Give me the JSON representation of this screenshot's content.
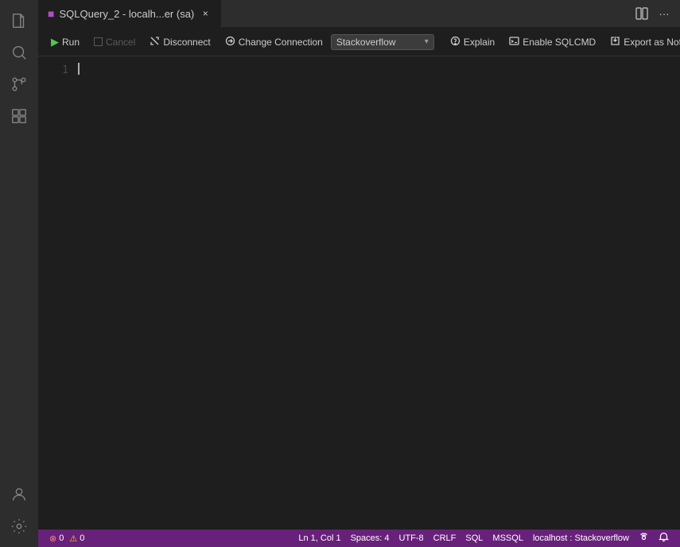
{
  "window": {
    "title": "SQLQuery_2 - localh...er (sa)"
  },
  "activity_bar": {
    "icons": [
      {
        "name": "files-icon",
        "symbol": "⧉",
        "tooltip": "Explorer"
      },
      {
        "name": "search-activity-icon",
        "symbol": "🔍",
        "tooltip": "Search"
      },
      {
        "name": "source-control-icon",
        "symbol": "⑂",
        "tooltip": "Source Control"
      },
      {
        "name": "extensions-icon",
        "symbol": "⊞",
        "tooltip": "Extensions"
      }
    ],
    "bottom_icons": [
      {
        "name": "account-icon",
        "symbol": "👤",
        "tooltip": "Account"
      },
      {
        "name": "settings-icon",
        "symbol": "⚙",
        "tooltip": "Settings"
      }
    ]
  },
  "tabs": [
    {
      "label": "SQLQuery_2 - localh...er (sa)",
      "icon": "■",
      "active": true,
      "close_label": "×"
    }
  ],
  "tab_bar_actions": [
    {
      "name": "split-editor-icon",
      "symbol": "⊟"
    },
    {
      "name": "more-actions-icon",
      "symbol": "⋯"
    }
  ],
  "toolbar": {
    "run_label": "Run",
    "cancel_label": "Cancel",
    "disconnect_label": "Disconnect",
    "change_connection_label": "Change Connection",
    "explain_label": "Explain",
    "enable_sqlcmd_label": "Enable SQLCMD",
    "export_notebook_label": "Export as Notebook",
    "connection_name": "Stackoverflow",
    "run_icon": "▶",
    "cancel_icon": "□",
    "disconnect_icon": "⚡",
    "connection_icon": "⚡",
    "explain_icon": "⚙",
    "sqlcmd_icon": "⊞",
    "export_icon": "↪"
  },
  "editor": {
    "line_number": "1",
    "content": ""
  },
  "status_bar": {
    "error_count": "0",
    "warning_count": "0",
    "position": "Ln 1, Col 1",
    "spaces": "Spaces: 4",
    "encoding": "UTF-8",
    "line_ending": "CRLF",
    "language": "SQL",
    "dialect": "MSSQL",
    "server": "localhost : Stackoverflow",
    "notification_icon": "🔔",
    "broadcast_icon": "📡"
  }
}
